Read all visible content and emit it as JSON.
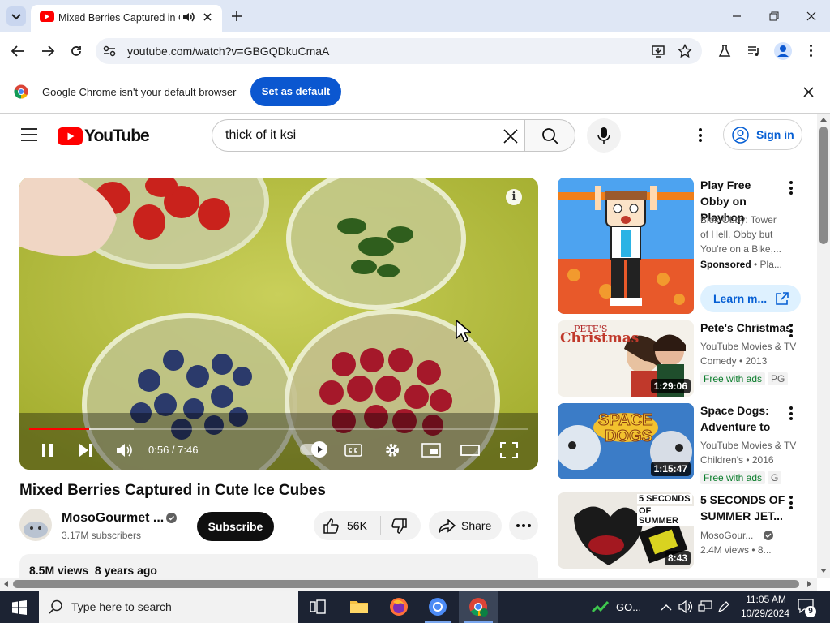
{
  "browser": {
    "tab_title": "Mixed Berries Captured in Cute Ice Cubes - YouTube",
    "url": "youtube.com/watch?v=GBGQDkuCmaA",
    "infobar_message": "Google Chrome isn't your default browser",
    "infobar_button": "Set as default"
  },
  "youtube": {
    "logo_text": "YouTube",
    "search_value": "thick of it ksi",
    "sign_in": "Sign in",
    "player": {
      "time": "0:56 / 7:46",
      "progress_fraction": 0.12
    },
    "video_title": "Mixed Berries Captured in Cute Ice Cubes",
    "channel_name": "MosoGourmet ...",
    "subscribers": "3.17M subscribers",
    "subscribe": "Subscribe",
    "likes": "56K",
    "share": "Share",
    "description_meta": "8.5M views  8 years ago",
    "sidebar": [
      {
        "title": "Play Free Obby on Playhop",
        "meta1": "Blox Obby: Tower of Hell, Obby but You're on a Bike,...",
        "sponsored": "Sponsored",
        "meta2": " • Pla...",
        "cta": "Learn m..."
      },
      {
        "title": "Pete's Christmas",
        "meta1": "YouTube Movies & TV",
        "meta2": "Comedy • 2013",
        "badge1": "Free with ads",
        "badge2": "PG",
        "duration": "1:29:06",
        "thumb_text1": "PETE'S",
        "thumb_text2": "Christmas"
      },
      {
        "title": "Space Dogs: Adventure to the...",
        "meta1": "YouTube Movies & TV",
        "meta2": "Children's • 2016",
        "badge1": "Free with ads",
        "badge2": "G",
        "duration": "1:15:47",
        "thumb_text1": "SPACE",
        "thumb_text2": "DOGS"
      },
      {
        "title": "5 SECONDS OF SUMMER JET...",
        "meta1": "MosoGour...",
        "meta2": "2.4M views • 8...",
        "duration": "8:43",
        "thumb_text1": "5 SECONDS",
        "thumb_text2": "OF SUMMER"
      }
    ]
  },
  "taskbar": {
    "search_placeholder": "Type here to search",
    "tray_label": "GO...",
    "time": "11:05 AM",
    "date": "10/29/2024",
    "notifications": "9"
  },
  "colors": {
    "accent": "#0b57d0",
    "yt_red": "#ff0000",
    "taskbar": "#1c2333"
  }
}
